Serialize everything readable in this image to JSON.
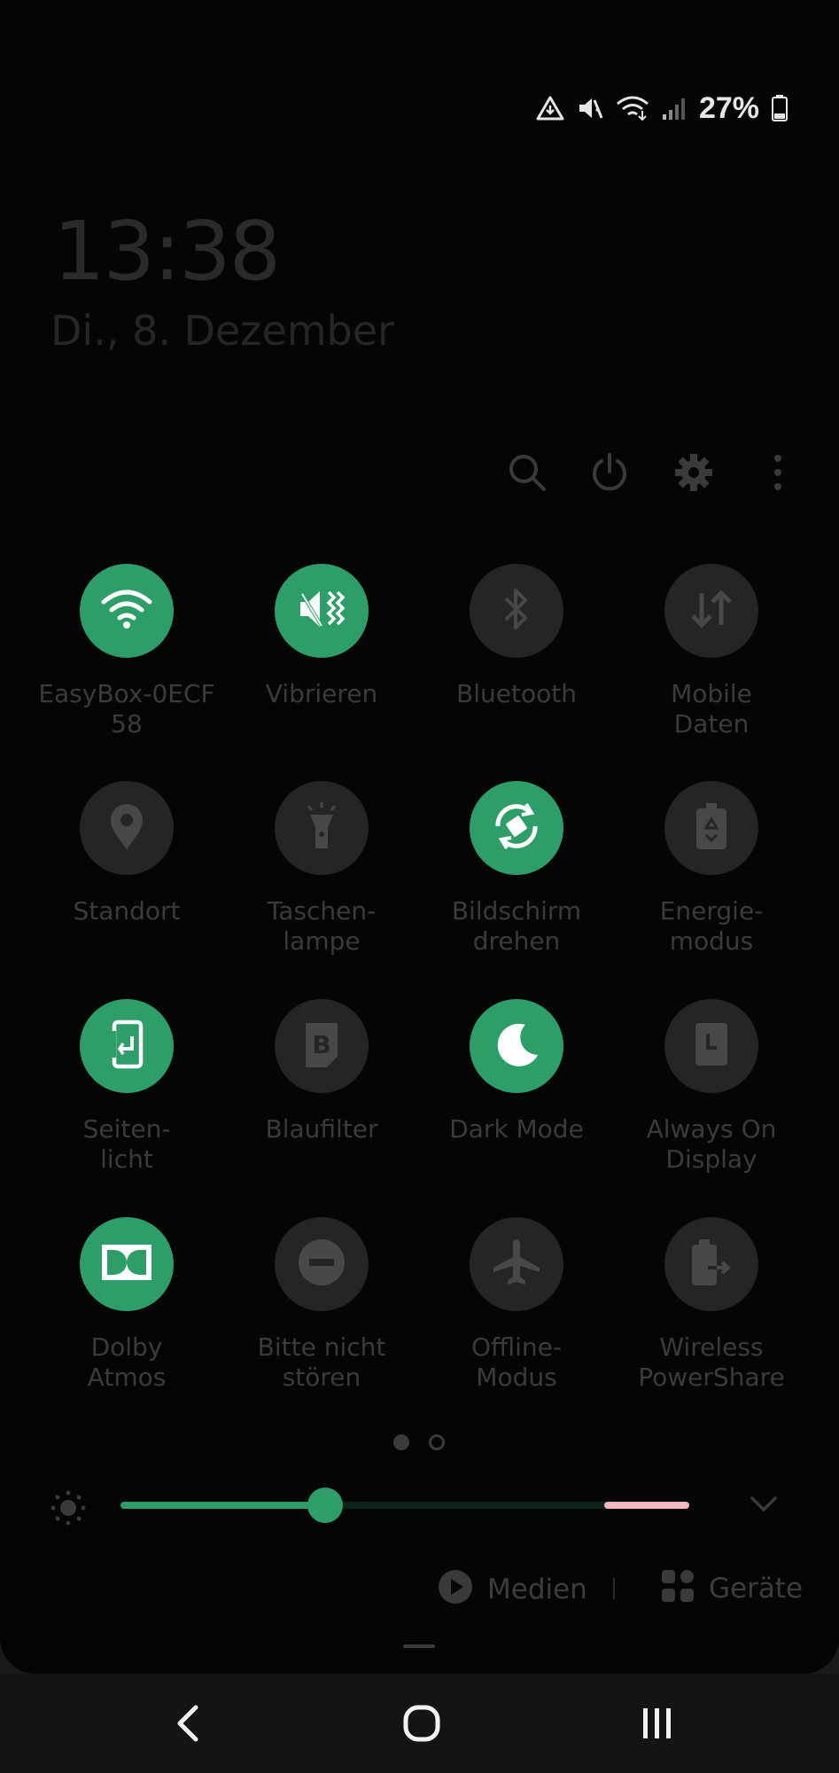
{
  "status_bar": {
    "battery": "27%"
  },
  "lockscreen": {
    "time": "13:38",
    "date": "Di., 8. Dezember"
  },
  "tiles": [
    {
      "id": "wifi",
      "label": "EasyBox-0ECF\n58",
      "active": true,
      "icon": "wifi-icon"
    },
    {
      "id": "sound",
      "label": "Vibrieren",
      "active": true,
      "icon": "vibrate-icon"
    },
    {
      "id": "bluetooth",
      "label": "Bluetooth",
      "active": false,
      "icon": "bluetooth-icon"
    },
    {
      "id": "mobile-data",
      "label": "Mobile\nDaten",
      "active": false,
      "icon": "mobile-data-icon"
    },
    {
      "id": "location",
      "label": "Standort",
      "active": false,
      "icon": "location-icon"
    },
    {
      "id": "flashlight",
      "label": "Taschen-\nlampe",
      "active": false,
      "icon": "flashlight-icon"
    },
    {
      "id": "rotate",
      "label": "Bildschirm\ndrehen",
      "active": true,
      "icon": "auto-rotate-icon"
    },
    {
      "id": "power-mode",
      "label": "Energie-\nmodus",
      "active": false,
      "icon": "power-saving-icon"
    },
    {
      "id": "edge-lighting",
      "label": "Seiten-\nlicht",
      "active": true,
      "icon": "edge-lighting-icon"
    },
    {
      "id": "blue-light",
      "label": "Blaufilter",
      "active": false,
      "icon": "blue-light-filter-icon"
    },
    {
      "id": "dark-mode",
      "label": "Dark Mode",
      "active": true,
      "icon": "moon-icon"
    },
    {
      "id": "aod",
      "label": "Always On\nDisplay",
      "active": false,
      "icon": "always-on-display-icon"
    },
    {
      "id": "dolby",
      "label": "Dolby\nAtmos",
      "active": true,
      "icon": "dolby-icon"
    },
    {
      "id": "dnd",
      "label": "Bitte nicht\nstören",
      "active": false,
      "icon": "do-not-disturb-icon"
    },
    {
      "id": "airplane",
      "label": "Offline-\nModus",
      "active": false,
      "icon": "airplane-icon"
    },
    {
      "id": "powershare",
      "label": "Wireless\nPowerShare",
      "active": false,
      "icon": "wireless-powershare-icon"
    }
  ],
  "brightness": {
    "level": 0.36,
    "warning_from": 0.85
  },
  "pager": {
    "pages": 2,
    "current": 1
  },
  "bottom": {
    "media_label": "Medien",
    "devices_label": "Geräte"
  },
  "colors": {
    "accent": "#2e9e68",
    "tile_off": "#252525",
    "warning": "#f2b8bf"
  }
}
